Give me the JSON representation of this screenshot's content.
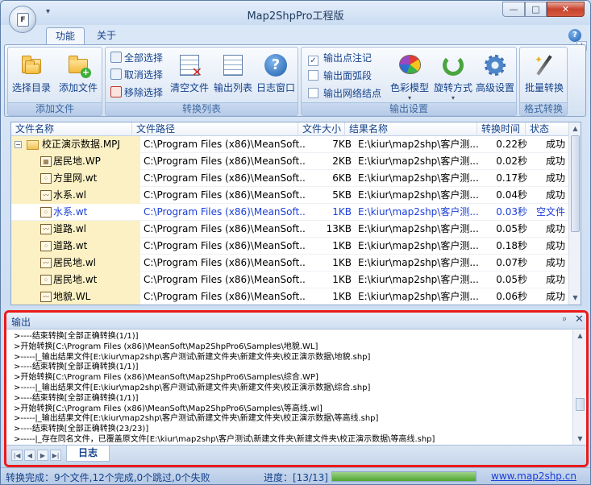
{
  "window": {
    "title": "Map2ShpPro工程版",
    "min_glyph": "—",
    "max_glyph": "□",
    "close_glyph": "✕",
    "orb_letter": "F",
    "qat_glyph": "▾"
  },
  "ribbon": {
    "tabs": [
      "功能",
      "关于"
    ],
    "help_glyph": "?",
    "collapse_glyph": "▲",
    "groups": {
      "add_files": {
        "label": "添加文件",
        "select_dir": "选择目录",
        "add_file": "添加文件"
      },
      "convert_list": {
        "label": "转换列表",
        "select_all": "全部选择",
        "deselect": "取消选择",
        "remove_selected": "移除选择",
        "clear_files": "清空文件",
        "output_list": "输出列表",
        "log_window": "日志窗口"
      },
      "output_settings": {
        "label": "输出设置",
        "output_point_note": "输出点注记",
        "output_point_note_checked": true,
        "output_arc": "输出面弧段",
        "output_grid_nodes": "输出网络结点",
        "color_model": "色彩模型",
        "rotate_mode": "旋转方式",
        "advanced": "高级设置"
      },
      "format_convert": {
        "label": "格式转换",
        "batch_convert": "批量转换"
      }
    }
  },
  "file_list": {
    "columns": [
      "文件名称",
      "文件路径",
      "文件大小",
      "结果名称",
      "转换时间",
      "状态"
    ],
    "root": {
      "name": "校正演示数据.MPJ",
      "path": "C:\\Program Files (x86)\\MeanSoft...",
      "size": "7KB",
      "result": "E:\\kiur\\map2shp\\客户测...",
      "time": "0.22秒",
      "status": "成功"
    },
    "rows": [
      {
        "icon": "wp",
        "name": "居民地.WP",
        "path": "C:\\Program Files (x86)\\MeanSoft...",
        "size": "2KB",
        "result": "E:\\kiur\\map2shp\\客户测...",
        "time": "0.02秒",
        "status": "成功",
        "highlight": true,
        "blue": false
      },
      {
        "icon": "wt",
        "name": "方里网.wt",
        "path": "C:\\Program Files (x86)\\MeanSoft...",
        "size": "6KB",
        "result": "E:\\kiur\\map2shp\\客户测...",
        "time": "0.17秒",
        "status": "成功",
        "highlight": true,
        "blue": false
      },
      {
        "icon": "wl",
        "name": "水系.wl",
        "path": "C:\\Program Files (x86)\\MeanSoft...",
        "size": "5KB",
        "result": "E:\\kiur\\map2shp\\客户测...",
        "time": "0.04秒",
        "status": "成功",
        "highlight": true,
        "blue": false
      },
      {
        "icon": "wt",
        "name": "水系.wt",
        "path": "C:\\Program Files (x86)\\MeanSoft...",
        "size": "1KB",
        "result": "E:\\kiur\\map2shp\\客户测...",
        "time": "0.03秒",
        "status": "空文件",
        "highlight": false,
        "blue": true
      },
      {
        "icon": "wl",
        "name": "道路.wl",
        "path": "C:\\Program Files (x86)\\MeanSoft...",
        "size": "13KB",
        "result": "E:\\kiur\\map2shp\\客户测...",
        "time": "0.05秒",
        "status": "成功",
        "highlight": true,
        "blue": false
      },
      {
        "icon": "wt",
        "name": "道路.wt",
        "path": "C:\\Program Files (x86)\\MeanSoft...",
        "size": "1KB",
        "result": "E:\\kiur\\map2shp\\客户测...",
        "time": "0.18秒",
        "status": "成功",
        "highlight": true,
        "blue": false
      },
      {
        "icon": "wl",
        "name": "居民地.wl",
        "path": "C:\\Program Files (x86)\\MeanSoft...",
        "size": "1KB",
        "result": "E:\\kiur\\map2shp\\客户测...",
        "time": "0.07秒",
        "status": "成功",
        "highlight": true,
        "blue": false
      },
      {
        "icon": "wt",
        "name": "居民地.wt",
        "path": "C:\\Program Files (x86)\\MeanSoft...",
        "size": "1KB",
        "result": "E:\\kiur\\map2shp\\客户测...",
        "time": "0.05秒",
        "status": "成功",
        "highlight": true,
        "blue": false
      },
      {
        "icon": "wl",
        "name": "地貌.WL",
        "path": "C:\\Program Files (x86)\\MeanSoft...",
        "size": "1KB",
        "result": "E:\\kiur\\map2shp\\客户测...",
        "time": "0.06秒",
        "status": "成功",
        "highlight": true,
        "blue": false
      }
    ]
  },
  "output_panel": {
    "title": "输出",
    "pin_glyph": "ᵖ",
    "close_glyph": "✕",
    "lines": [
      ">----结束转换[全部正确转换(1/1)]",
      ">开始转换[C:\\Program Files (x86)\\MeanSoft\\Map2ShpPro6\\Samples\\地貌.WL]",
      ">-----|_输出结果文件[E:\\kiur\\map2shp\\客户测试\\新建文件夹\\新建文件夹\\校正演示数据\\地貌.shp]",
      ">----结束转换[全部正确转换(1/1)]",
      ">开始转换[C:\\Program Files (x86)\\MeanSoft\\Map2ShpPro6\\Samples\\综合.WP]",
      ">-----|_输出结果文件[E:\\kiur\\map2shp\\客户测试\\新建文件夹\\新建文件夹\\校正演示数据\\综合.shp]",
      ">----结束转换[全部正确转换(1/1)]",
      ">开始转换[C:\\Program Files (x86)\\MeanSoft\\Map2ShpPro6\\Samples\\等高线.wl]",
      ">-----|_输出结果文件[E:\\kiur\\map2shp\\客户测试\\新建文件夹\\新建文件夹\\校正演示数据\\等高线.shp]",
      ">----结束转换[全部正确转换(23/23)]",
      ">-----|_存在同名文件，已覆盖原文件[E:\\kiur\\map2shp\\客户测试\\新建文件夹\\新建文件夹\\校正演示数据\\等高线.shp]"
    ],
    "tab_label": "日志",
    "nav": [
      "|◀",
      "◀",
      "▶",
      "▶|"
    ]
  },
  "status_bar": {
    "summary": "转换完成：9个文件,12个完成,0个跳过,0个失败",
    "progress_label": "进度：[13/13]",
    "progress_fraction": 1.0,
    "link": "www.map2shp.cn"
  },
  "colors": {
    "accent": "#15428b",
    "highlight_red_border": "#ea1b1b",
    "row_highlight": "#fbf1c4",
    "link_blue": "#1a3fd8"
  },
  "icons": {
    "select_dir": "folder-stack-icon",
    "add_file": "folder-plus-icon",
    "clear_files": "grid-clear-icon",
    "output_list": "grid-list-icon",
    "log_window": "help-circle-icon",
    "color_model": "palette-icon",
    "rotate_mode": "rotate-icon",
    "advanced": "gear-icon",
    "batch_convert": "magic-wand-icon"
  }
}
